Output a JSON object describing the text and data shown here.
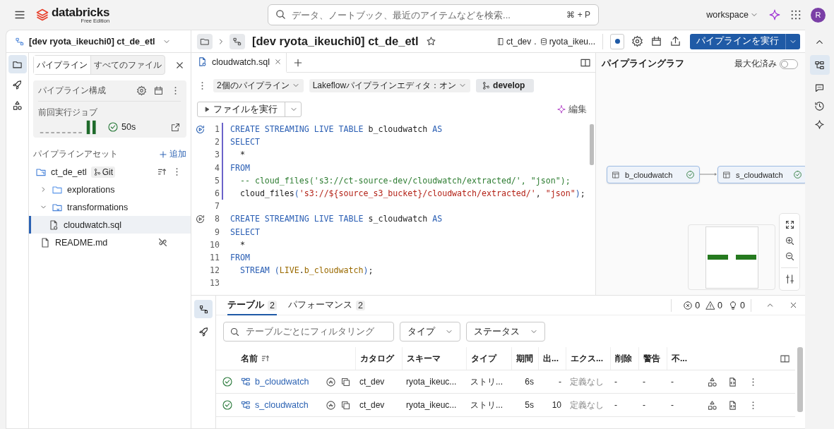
{
  "top_bar": {
    "brand": "databricks",
    "brand_sub": "Free Edition",
    "search": {
      "placeholder": "データ、ノートブック、最近のアイテムなどを検索...",
      "shortcut": "⌘ + P"
    },
    "workspace": "workspace",
    "avatar": "R"
  },
  "left_pane": {
    "title": "[dev ryota_ikeuchi0] ct_de_etl",
    "rail": [
      {
        "selected": true
      },
      {
        "selected": false
      },
      {
        "selected": false
      }
    ],
    "tabs": [
      {
        "label": "パイプライン",
        "selected": true
      },
      {
        "label": "すべてのファイル",
        "selected": false
      }
    ],
    "config": {
      "title": "パイプライン構成",
      "last_run_label": "前回実行ジョブ",
      "last_run_duration": "50s"
    },
    "assets_title": "パイプラインアセット",
    "add_label": "追加",
    "tree": [
      {
        "name": "ct_de_etl",
        "kind": "root",
        "badge": "Git",
        "selected": false,
        "children": [
          {
            "name": "explorations",
            "kind": "folder",
            "selected": false,
            "expanded": false
          },
          {
            "name": "transformations",
            "kind": "source-folder",
            "selected": false,
            "expanded": true,
            "children": [
              {
                "name": "cloudwatch.sql",
                "kind": "sql",
                "selected": true
              }
            ]
          },
          {
            "name": "README.md",
            "kind": "file",
            "selected": false,
            "unlinked": true
          }
        ]
      }
    ]
  },
  "header": {
    "title": "[dev ryota_ikeuchi0] ct_de_etl",
    "catalog": "ct_dev",
    "separator": ".",
    "schema": "ryota_ikeu...",
    "run_button": "パイプラインを実行"
  },
  "editor": {
    "tabs": [
      {
        "label": "cloudwatch.sql",
        "selected": true
      }
    ],
    "dropdowns": [
      "2個のパイプライン",
      "Lakeflowパイプラインエディタ：オン"
    ],
    "branch": "develop",
    "run_file": "ファイルを実行",
    "ai_edit": "編集",
    "lines": [
      {
        "number": "1",
        "run": true,
        "in_block": true,
        "tokens": [
          {
            "kind": "keyword",
            "text": "CREATE STREAMING LIVE TABLE"
          },
          {
            "kind": "plain",
            "text": " b_cloudwatch "
          },
          {
            "kind": "keyword",
            "text": "AS"
          }
        ]
      },
      {
        "number": "2",
        "run": false,
        "in_block": true,
        "tokens": [
          {
            "kind": "keyword",
            "text": "SELECT"
          }
        ]
      },
      {
        "number": "3",
        "run": false,
        "in_block": true,
        "tokens": [
          {
            "kind": "plain",
            "text": "  *"
          }
        ]
      },
      {
        "number": "4",
        "run": false,
        "in_block": true,
        "tokens": [
          {
            "kind": "keyword",
            "text": "FROM"
          }
        ]
      },
      {
        "number": "5",
        "run": false,
        "in_block": true,
        "tokens": [
          {
            "kind": "comment",
            "text": "  -- cloud_files('s3://ct-source-dev/cloudwatch/extracted/', \"json\");"
          }
        ]
      },
      {
        "number": "6",
        "run": false,
        "in_block": true,
        "tokens": [
          {
            "kind": "plain",
            "text": "  cloud_files"
          },
          {
            "kind": "paren",
            "text": "("
          },
          {
            "kind": "string",
            "text": "'s3://${source_s3_bucket}/cloudwatch/extracted/'"
          },
          {
            "kind": "plain",
            "text": ", "
          },
          {
            "kind": "string",
            "text": "\"json\""
          },
          {
            "kind": "paren",
            "text": ")"
          },
          {
            "kind": "plain",
            "text": ";"
          }
        ]
      },
      {
        "number": "7",
        "run": false,
        "in_block": false
      },
      {
        "number": "8",
        "run": true,
        "in_block": false,
        "tokens": [
          {
            "kind": "keyword",
            "text": "CREATE STREAMING LIVE TABLE"
          },
          {
            "kind": "plain",
            "text": " s_cloudwatch "
          },
          {
            "kind": "keyword",
            "text": "AS"
          }
        ]
      },
      {
        "number": "9",
        "run": false,
        "in_block": false,
        "tokens": [
          {
            "kind": "keyword",
            "text": "SELECT"
          }
        ]
      },
      {
        "number": "10",
        "run": false,
        "in_block": false,
        "tokens": [
          {
            "kind": "plain",
            "text": "  *"
          }
        ]
      },
      {
        "number": "11",
        "run": false,
        "in_block": false,
        "tokens": [
          {
            "kind": "keyword",
            "text": "FROM"
          }
        ]
      },
      {
        "number": "12",
        "run": false,
        "in_block": false,
        "tokens": [
          {
            "kind": "keyword",
            "text": "  STREAM"
          },
          {
            "kind": "paren",
            "text": " ("
          },
          {
            "kind": "ref",
            "text": "LIVE"
          },
          {
            "kind": "plain",
            "text": "."
          },
          {
            "kind": "ref",
            "text": "b_cloudwatch"
          },
          {
            "kind": "paren",
            "text": ")"
          },
          {
            "kind": "plain",
            "text": ";"
          }
        ]
      },
      {
        "number": "13",
        "run": false,
        "in_block": false
      }
    ]
  },
  "graph": {
    "title": "パイプライングラフ",
    "maximize_label": "最大化済み",
    "maximized": false,
    "nodes": [
      {
        "name": "b_cloudwatch",
        "succeeded": true
      },
      {
        "name": "s_cloudwatch",
        "succeeded": true
      }
    ]
  },
  "bottom": {
    "rail": [
      {
        "selected": true
      },
      {
        "selected": false
      }
    ],
    "tabs": [
      {
        "label": "テーブル",
        "count": "2",
        "selected": true
      },
      {
        "label": "パフォーマンス",
        "count": "2",
        "selected": false
      }
    ],
    "errors": "0",
    "warnings": "0",
    "suggestions": "0",
    "filter_placeholder": "テーブルごとにフィルタリング",
    "filters": [
      "タイプ",
      "ステータス"
    ],
    "columns": [
      "名前",
      "カタログ",
      "スキーマ",
      "タイプ",
      "期間",
      "出...",
      "エクス...",
      "削除",
      "警告",
      "不..."
    ],
    "rows": [
      {
        "succeeded": true,
        "cells": [
          "b_cloudwatch",
          "ct_dev",
          "ryota_ikeuc...",
          "ストリ...",
          "6s",
          "-",
          "定義なし",
          "-",
          "-",
          "-"
        ]
      },
      {
        "succeeded": true,
        "cells": [
          "s_cloudwatch",
          "ct_dev",
          "ryota_ikeuc...",
          "ストリ...",
          "5s",
          "10",
          "定義なし",
          "-",
          "-",
          "-"
        ]
      }
    ]
  }
}
